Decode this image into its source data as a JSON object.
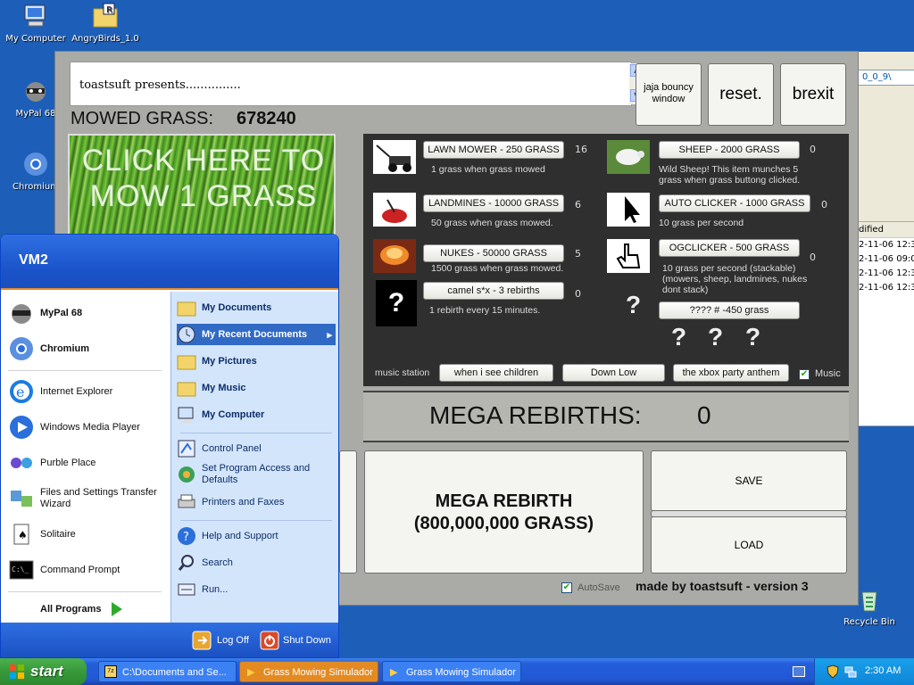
{
  "desktop": {
    "icons": [
      {
        "label": "My Computer"
      },
      {
        "label": "AngryBirds_1.0"
      },
      {
        "label": "MyPal 68"
      },
      {
        "label": "Chromium"
      },
      {
        "label": "Recycle Bin"
      }
    ]
  },
  "explorer": {
    "address_fragment": "0_0_9\\",
    "column_header": "dified",
    "rows": [
      "2-11-06 12:3",
      "2-11-06 09:0",
      "2-11-06 12:3",
      "2-11-06 12:3"
    ]
  },
  "game": {
    "message": "toastsuft presents...............",
    "buttons": {
      "jaja": "jaja bouncy window",
      "reset": "reset.",
      "brexit": "brexit",
      "mega_rebirth": "MEGA REBIRTH (800,000,000 GRASS)",
      "save": "SAVE",
      "load": "LOAD"
    },
    "mowed_label": "MOWED GRASS:",
    "mowed_value": "678240",
    "click_text": "CLICK HERE TO MOW 1 GRASS",
    "shop": {
      "lawn_mower": {
        "label": "LAWN MOWER - 250 GRASS",
        "count": "16",
        "desc": "1 grass when grass mowed"
      },
      "landmines": {
        "label": "LANDMINES - 10000 GRASS",
        "count": "6",
        "desc": "50 grass when grass mowed."
      },
      "nukes": {
        "label": "NUKES - 50000 GRASS",
        "count": "5",
        "desc": "1500 grass when grass mowed."
      },
      "camel": {
        "label": "camel s*x - 3 rebirths",
        "count": "0",
        "desc": "1 rebirth every 15 minutes."
      },
      "sheep": {
        "label": "SHEEP - 2000 GRASS",
        "count": "0",
        "desc": "Wild Sheep! This item munches 5 grass when grass buttong clicked."
      },
      "autoclicker": {
        "label": "AUTO CLICKER - 1000 GRASS",
        "count": "0",
        "desc": "10 grass per second"
      },
      "ogclicker": {
        "label": "OGCLICKER - 500 GRASS",
        "count": "0",
        "desc": "10 grass per second (stackable) (mowers, sheep, landmines, nukes dont stack)"
      },
      "mystery": {
        "label": "???? # -450 grass"
      },
      "question": "?"
    },
    "music": {
      "label": "music station",
      "tracks": [
        "when i see children",
        "Down Low",
        "the xbox party anthem"
      ],
      "toggle_label": "Music"
    },
    "mega_label": "MEGA REBIRTHS:",
    "mega_value": "0",
    "autosave_label": "AutoSave",
    "credit": "made by toastsuft - version 3"
  },
  "startmenu": {
    "user": "VM2",
    "pinned": [
      "MyPal 68",
      "Chromium"
    ],
    "recent": [
      "Internet Explorer",
      "Windows Media Player",
      "Purble Place",
      "Files and Settings Transfer Wizard",
      "Solitaire",
      "Command Prompt"
    ],
    "all_programs": "All Programs",
    "right_top": [
      "My Documents",
      "My Recent Documents",
      "My Pictures",
      "My Music",
      "My Computer"
    ],
    "right_mid": [
      "Control Panel",
      "Set Program Access and Defaults",
      "Printers and Faxes"
    ],
    "right_bot": [
      "Help and Support",
      "Search",
      "Run..."
    ],
    "logoff": "Log Off",
    "shutdown": "Shut Down"
  },
  "taskbar": {
    "start": "start",
    "tasks": [
      "C:\\Documents and Se...",
      "Grass Mowing Simulador",
      "Grass Mowing Simulador"
    ],
    "clock": "2:30 AM"
  },
  "colors": {
    "desktop": "#1d5fb8",
    "shop_panel": "#2f2f2f",
    "start_blue": "#245edb",
    "start_green": "#37993a"
  }
}
